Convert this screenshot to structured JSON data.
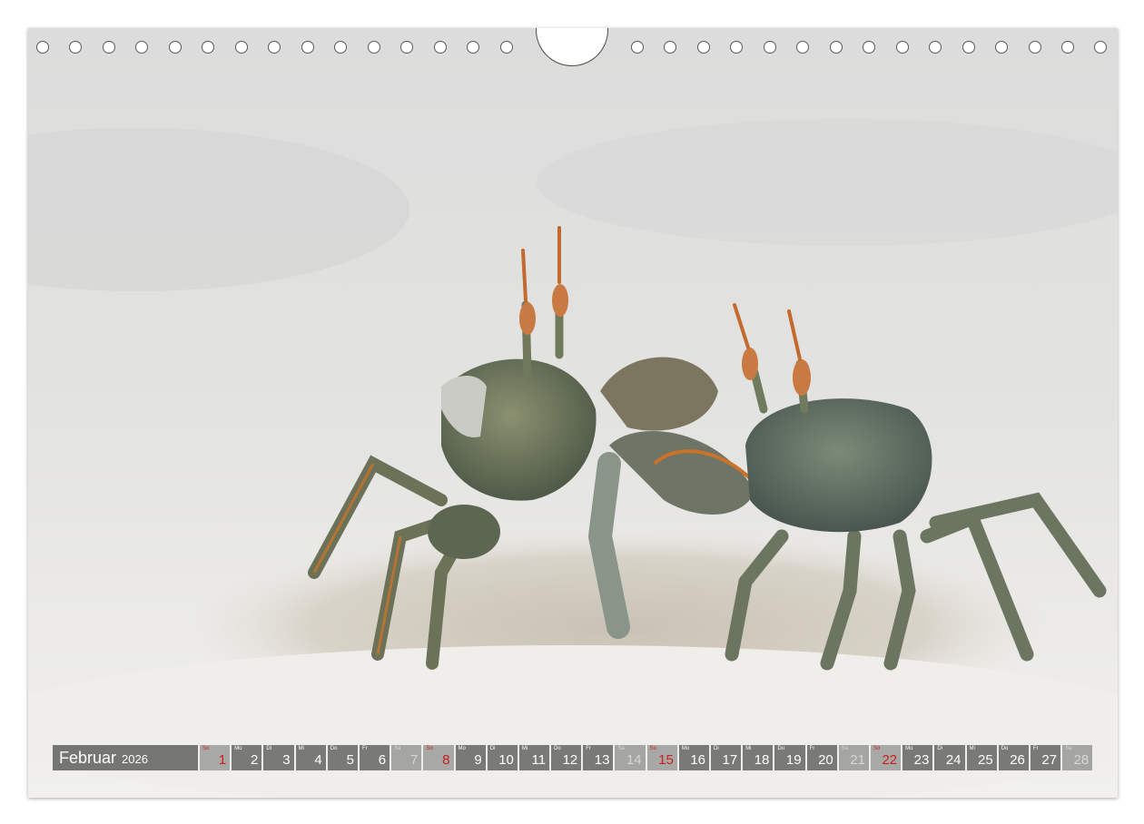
{
  "calendar": {
    "month": "Februar",
    "year": "2026",
    "days": [
      {
        "wd": "So",
        "n": "1",
        "kind": "hol"
      },
      {
        "wd": "Mo",
        "n": "2",
        "kind": "wd"
      },
      {
        "wd": "Di",
        "n": "3",
        "kind": "wd"
      },
      {
        "wd": "Mi",
        "n": "4",
        "kind": "wd"
      },
      {
        "wd": "Do",
        "n": "5",
        "kind": "wd"
      },
      {
        "wd": "Fr",
        "n": "6",
        "kind": "wd"
      },
      {
        "wd": "Sa",
        "n": "7",
        "kind": "we"
      },
      {
        "wd": "So",
        "n": "8",
        "kind": "hol"
      },
      {
        "wd": "Mo",
        "n": "9",
        "kind": "wd"
      },
      {
        "wd": "Di",
        "n": "10",
        "kind": "wd"
      },
      {
        "wd": "Mi",
        "n": "11",
        "kind": "wd"
      },
      {
        "wd": "Do",
        "n": "12",
        "kind": "wd"
      },
      {
        "wd": "Fr",
        "n": "13",
        "kind": "wd"
      },
      {
        "wd": "Sa",
        "n": "14",
        "kind": "we"
      },
      {
        "wd": "So",
        "n": "15",
        "kind": "hol"
      },
      {
        "wd": "Mo",
        "n": "16",
        "kind": "wd"
      },
      {
        "wd": "Di",
        "n": "17",
        "kind": "wd"
      },
      {
        "wd": "Mi",
        "n": "18",
        "kind": "wd"
      },
      {
        "wd": "Do",
        "n": "19",
        "kind": "wd"
      },
      {
        "wd": "Fr",
        "n": "20",
        "kind": "wd"
      },
      {
        "wd": "Sa",
        "n": "21",
        "kind": "we"
      },
      {
        "wd": "So",
        "n": "22",
        "kind": "hol"
      },
      {
        "wd": "Mo",
        "n": "23",
        "kind": "wd"
      },
      {
        "wd": "Di",
        "n": "24",
        "kind": "wd"
      },
      {
        "wd": "Mi",
        "n": "25",
        "kind": "wd"
      },
      {
        "wd": "Do",
        "n": "26",
        "kind": "wd"
      },
      {
        "wd": "Fr",
        "n": "27",
        "kind": "wd"
      },
      {
        "wd": "Sa",
        "n": "28",
        "kind": "we"
      }
    ]
  },
  "colors": {
    "sand": "#d9d9d7",
    "crab_body": "#6f7a5a",
    "crab_orange": "#c9732a",
    "holiday_red": "#c8201e"
  }
}
